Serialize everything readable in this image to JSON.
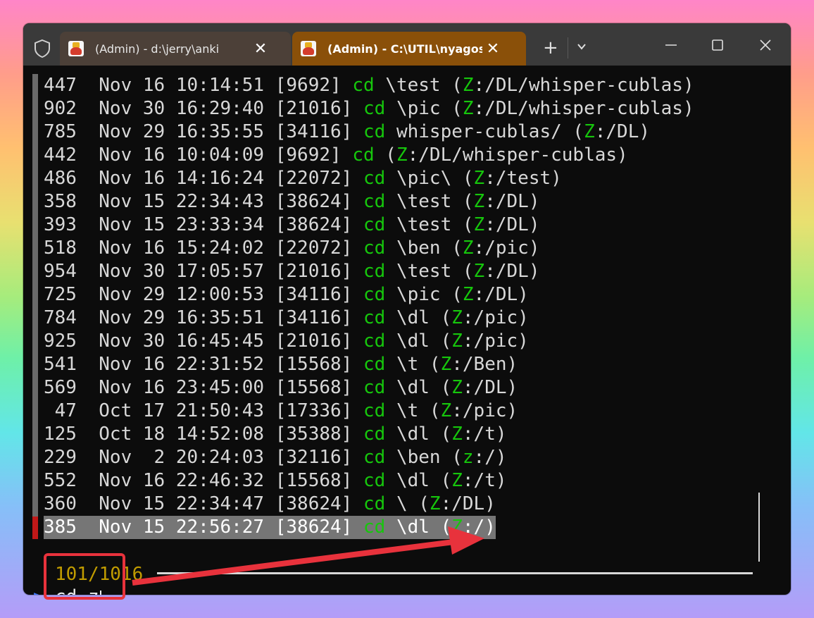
{
  "tabs": [
    {
      "title": "(Admin) - d:\\jerry\\anki",
      "close": "✕",
      "active": false
    },
    {
      "title": "(Admin) - C:\\UTIL\\nyagos\\nyagos.exe",
      "close": "✕",
      "active": true
    }
  ],
  "new_tab_label": "+",
  "history": [
    {
      "num": "447",
      "date": "Nov 16",
      "time": "10:14:51",
      "pid": "[9692]",
      "cmd": "cd",
      "arg": "\\test",
      "dir_open": "(",
      "drive": "Z",
      "dir_rest": ":/DL/whisper-cublas)",
      "selected": false
    },
    {
      "num": "902",
      "date": "Nov 30",
      "time": "16:29:40",
      "pid": "[21016]",
      "cmd": "cd",
      "arg": "\\pic",
      "dir_open": "(",
      "drive": "Z",
      "dir_rest": ":/DL/whisper-cublas)",
      "selected": false
    },
    {
      "num": "785",
      "date": "Nov 29",
      "time": "16:35:55",
      "pid": "[34116]",
      "cmd": "cd",
      "arg": "whisper-cublas/",
      "dir_open": "(",
      "drive": "Z",
      "dir_rest": ":/DL)",
      "selected": false
    },
    {
      "num": "442",
      "date": "Nov 16",
      "time": "10:04:09",
      "pid": "[9692]",
      "cmd": "cd",
      "arg": "",
      "dir_open": "(",
      "drive": "Z",
      "dir_rest": ":/DL/whisper-cublas)",
      "selected": false
    },
    {
      "num": "486",
      "date": "Nov 16",
      "time": "14:16:24",
      "pid": "[22072]",
      "cmd": "cd",
      "arg": "\\pic\\",
      "dir_open": "(",
      "drive": "Z",
      "dir_rest": ":/test)",
      "selected": false
    },
    {
      "num": "358",
      "date": "Nov 15",
      "time": "22:34:43",
      "pid": "[38624]",
      "cmd": "cd",
      "arg": "\\test",
      "dir_open": "(",
      "drive": "Z",
      "dir_rest": ":/DL)",
      "selected": false
    },
    {
      "num": "393",
      "date": "Nov 15",
      "time": "23:33:34",
      "pid": "[38624]",
      "cmd": "cd",
      "arg": "\\test",
      "dir_open": "(",
      "drive": "Z",
      "dir_rest": ":/DL)",
      "selected": false
    },
    {
      "num": "518",
      "date": "Nov 16",
      "time": "15:24:02",
      "pid": "[22072]",
      "cmd": "cd",
      "arg": "\\ben",
      "dir_open": "(",
      "drive": "Z",
      "dir_rest": ":/pic)",
      "selected": false
    },
    {
      "num": "954",
      "date": "Nov 30",
      "time": "17:05:57",
      "pid": "[21016]",
      "cmd": "cd",
      "arg": "\\test",
      "dir_open": "(",
      "drive": "Z",
      "dir_rest": ":/DL)",
      "selected": false
    },
    {
      "num": "725",
      "date": "Nov 29",
      "time": "12:00:53",
      "pid": "[34116]",
      "cmd": "cd",
      "arg": "\\pic",
      "dir_open": "(",
      "drive": "Z",
      "dir_rest": ":/DL)",
      "selected": false
    },
    {
      "num": "784",
      "date": "Nov 29",
      "time": "16:35:51",
      "pid": "[34116]",
      "cmd": "cd",
      "arg": "\\dl",
      "dir_open": "(",
      "drive": "Z",
      "dir_rest": ":/pic)",
      "selected": false
    },
    {
      "num": "925",
      "date": "Nov 30",
      "time": "16:45:45",
      "pid": "[21016]",
      "cmd": "cd",
      "arg": "\\dl",
      "dir_open": "(",
      "drive": "Z",
      "dir_rest": ":/pic)",
      "selected": false
    },
    {
      "num": "541",
      "date": "Nov 16",
      "time": "22:31:52",
      "pid": "[15568]",
      "cmd": "cd",
      "arg": "\\t",
      "dir_open": "(",
      "drive": "Z",
      "dir_rest": ":/Ben)",
      "selected": false
    },
    {
      "num": "569",
      "date": "Nov 16",
      "time": "23:45:00",
      "pid": "[15568]",
      "cmd": "cd",
      "arg": "\\dl",
      "dir_open": "(",
      "drive": "Z",
      "dir_rest": ":/DL)",
      "selected": false
    },
    {
      "num": " 47",
      "date": "Oct 17",
      "time": "21:50:43",
      "pid": "[17336]",
      "cmd": "cd",
      "arg": "\\t",
      "dir_open": "(",
      "drive": "Z",
      "dir_rest": ":/pic)",
      "selected": false
    },
    {
      "num": "125",
      "date": "Oct 18",
      "time": "14:52:08",
      "pid": "[35388]",
      "cmd": "cd",
      "arg": "\\dl",
      "dir_open": "(",
      "drive": "Z",
      "dir_rest": ":/t)",
      "selected": false
    },
    {
      "num": "229",
      "date": "Nov  2",
      "time": "20:24:03",
      "pid": "[32116]",
      "cmd": "cd",
      "arg": "\\ben",
      "dir_open": "(",
      "drive": "z",
      "dir_rest": ":/)",
      "selected": false
    },
    {
      "num": "552",
      "date": "Nov 16",
      "time": "22:46:32",
      "pid": "[15568]",
      "cmd": "cd",
      "arg": "\\dl",
      "dir_open": "(",
      "drive": "Z",
      "dir_rest": ":/t)",
      "selected": false
    },
    {
      "num": "360",
      "date": "Nov 15",
      "time": "22:34:47",
      "pid": "[38624]",
      "cmd": "cd",
      "arg": "\\",
      "dir_open": "(",
      "drive": "Z",
      "dir_rest": ":/DL)",
      "selected": false
    },
    {
      "num": "385",
      "date": "Nov 15",
      "time": "22:56:27",
      "pid": "[38624]",
      "cmd": "cd",
      "arg": "\\dl",
      "dir_open": "(",
      "drive": "Z",
      "dir_rest": ":/)",
      "selected": true
    }
  ],
  "status": "101/1016",
  "prompt_symbol": ">",
  "input": "cd z",
  "colors": {
    "cmd_green": "#16c60c",
    "status_gold": "#c19c00",
    "prompt_blue": "#3b78ff",
    "annotation_red": "#e8323c",
    "active_tab": "#8a5009"
  }
}
